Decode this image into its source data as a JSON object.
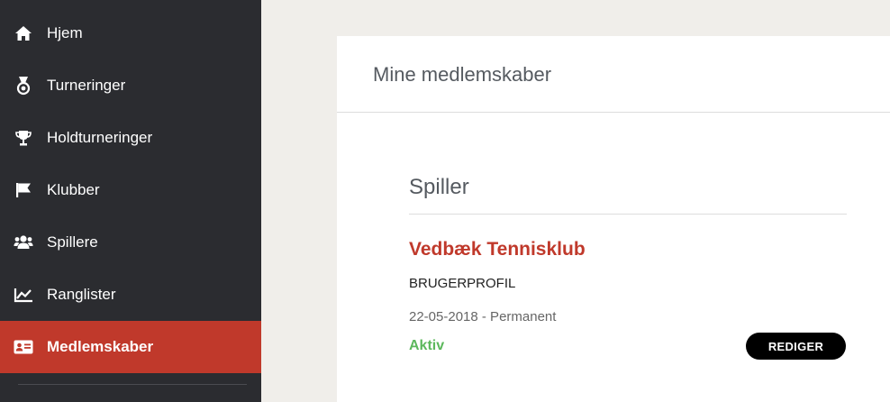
{
  "sidebar": {
    "items": [
      {
        "label": "Hjem",
        "icon": "home-icon"
      },
      {
        "label": "Turneringer",
        "icon": "medal-icon"
      },
      {
        "label": "Holdturneringer",
        "icon": "trophy-icon"
      },
      {
        "label": "Klubber",
        "icon": "flag-icon"
      },
      {
        "label": "Spillere",
        "icon": "users-icon"
      },
      {
        "label": "Ranglister",
        "icon": "chart-line-icon"
      },
      {
        "label": "Medlemskaber",
        "icon": "id-card-icon",
        "active": true
      }
    ]
  },
  "main": {
    "title": "Mine medlemskaber",
    "section": {
      "title": "Spiller",
      "membership": {
        "club": "Vedbæk Tennisklub",
        "profile": "BRUGERPROFIL",
        "period": "22-05-2018 - Permanent",
        "status": "Aktiv",
        "edit_label": "REDIGER"
      }
    }
  },
  "colors": {
    "sidebar_bg": "#2b2c30",
    "active_bg": "#c0392b",
    "accent_red": "#c0392b",
    "status_green": "#5cb85c",
    "page_bg": "#f0eeea"
  }
}
